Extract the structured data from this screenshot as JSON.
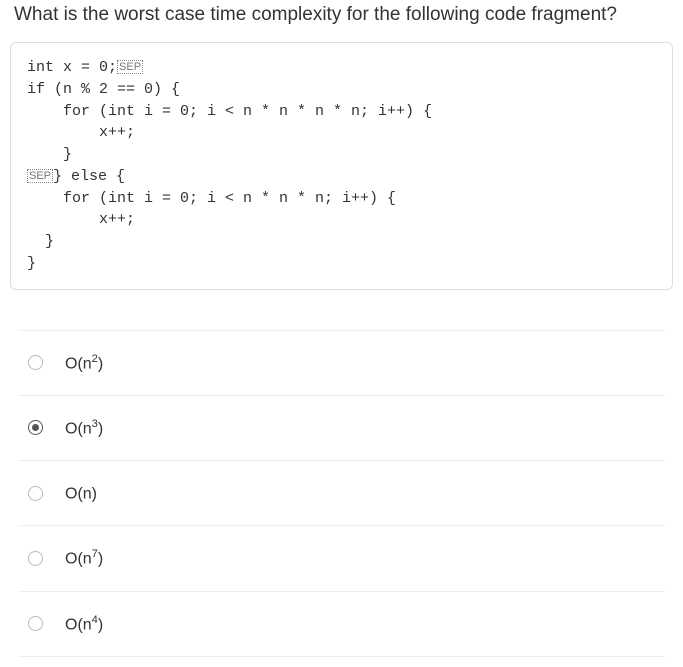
{
  "question": "What is the worst case time complexity for the following code fragment?",
  "code": {
    "l1a": "int x = 0;",
    "l1_sep": "SEP",
    "l2": "if (n % 2 == 0) {",
    "l3": "    for (int i = 0; i < n * n * n * n; i++) {",
    "l4": "        x++;",
    "l5": "    }",
    "l6_sep": "SEP",
    "l6b": "} else {",
    "l7": "    for (int i = 0; i < n * n * n; i++) {",
    "l8": "        x++;",
    "l9": "  }",
    "l10": "}"
  },
  "answers": [
    {
      "base": "O(n",
      "exp": "2",
      "tail": ")",
      "selected": false
    },
    {
      "base": "O(n",
      "exp": "3",
      "tail": ")",
      "selected": true
    },
    {
      "base": "O(n)",
      "exp": "",
      "tail": "",
      "selected": false
    },
    {
      "base": "O(n",
      "exp": "7",
      "tail": ")",
      "selected": false
    },
    {
      "base": "O(n",
      "exp": "4",
      "tail": ")",
      "selected": false
    }
  ]
}
